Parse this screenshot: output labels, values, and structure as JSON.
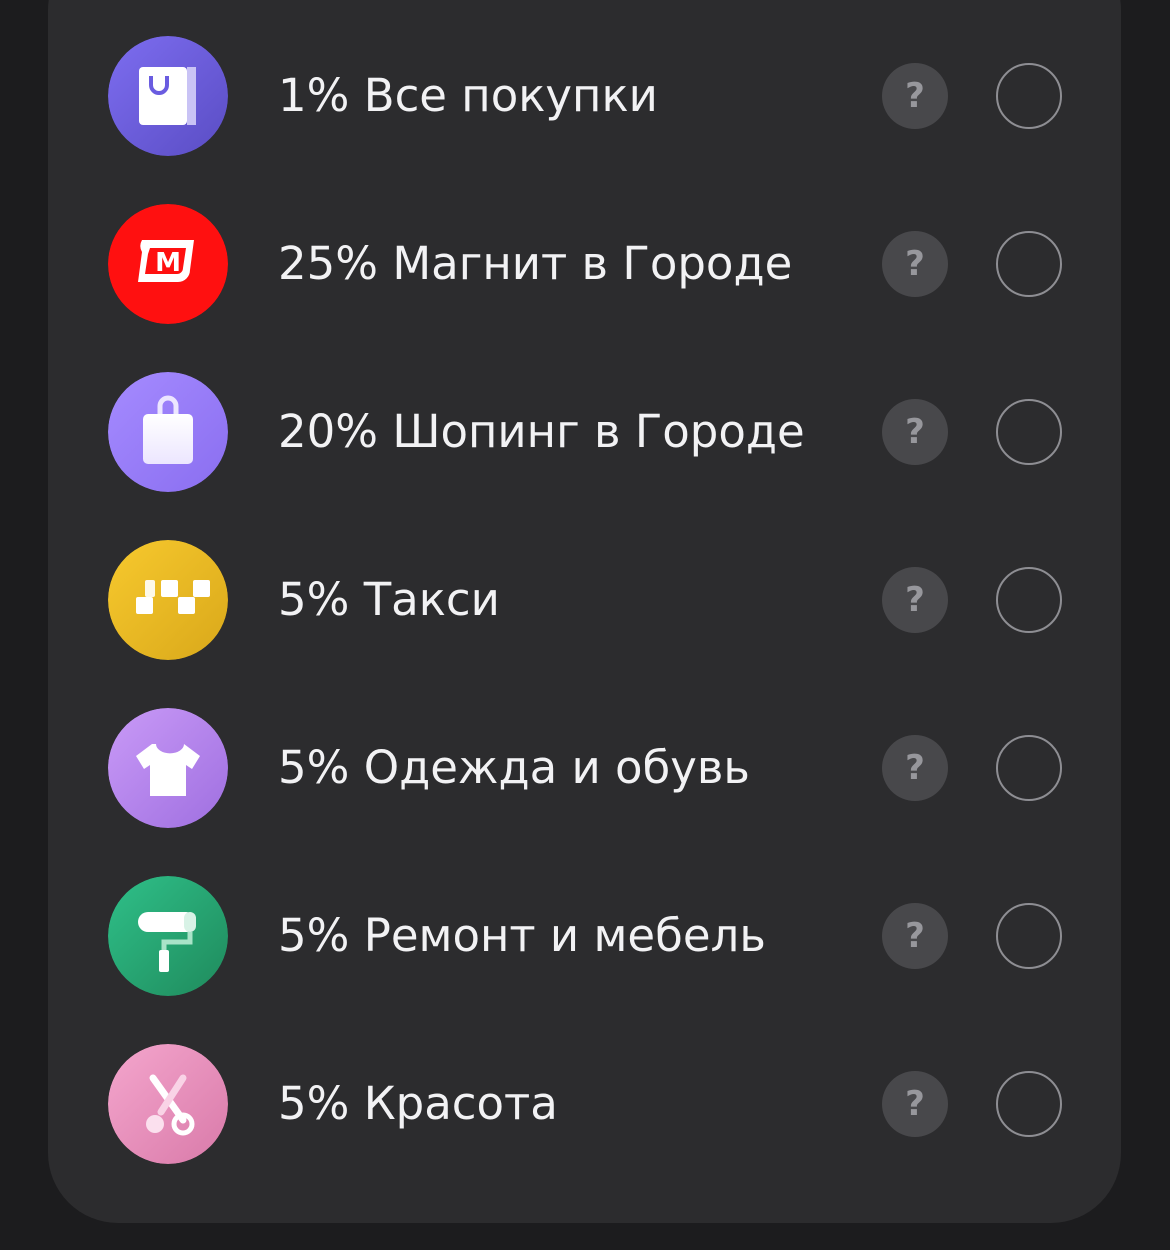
{
  "categories": [
    {
      "label": "1% Все покупки",
      "icon": "shopping-bag-icon",
      "color_from": "#7d6df0",
      "color_to": "#5a4dc4",
      "help_label": "?",
      "selected": false
    },
    {
      "label": "25% Магнит в Городе",
      "icon": "magnit-logo-icon",
      "color_from": "#ff1616",
      "color_to": "#f00000",
      "help_label": "?",
      "selected": false
    },
    {
      "label": "20% Шопинг в Городе",
      "icon": "bag-icon",
      "color_from": "#a58bff",
      "color_to": "#8a6ef0",
      "help_label": "?",
      "selected": false
    },
    {
      "label": "5% Такси",
      "icon": "taxi-checker-icon",
      "color_from": "#f7c92e",
      "color_to": "#d9a81a",
      "help_label": "?",
      "selected": false
    },
    {
      "label": "5% Одежда и обувь",
      "icon": "t-shirt-icon",
      "color_from": "#c99af7",
      "color_to": "#9f6fe0",
      "help_label": "?",
      "selected": false
    },
    {
      "label": "5% Ремонт и мебель",
      "icon": "paint-roller-icon",
      "color_from": "#2fc089",
      "color_to": "#1f8a5c",
      "help_label": "?",
      "selected": false
    },
    {
      "label": "5% Красота",
      "icon": "scissors-icon",
      "color_from": "#f4a6cd",
      "color_to": "#d97aa9",
      "help_label": "?",
      "selected": false
    }
  ]
}
